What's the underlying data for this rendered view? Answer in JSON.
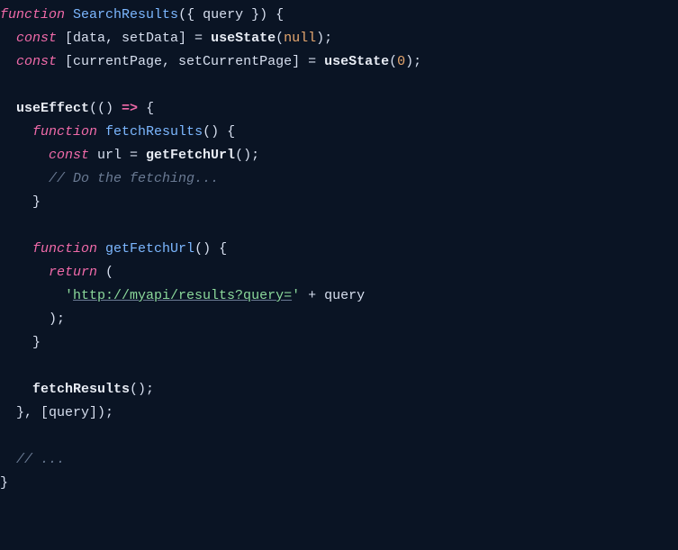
{
  "t": {
    "fn_kw": "function",
    "fn1": "SearchResults",
    "param_open": "({ ",
    "param_q": "query",
    "param_close": " }) {",
    "const_kw": "const",
    "destr1": " [data, setData] = ",
    "useState": "useState",
    "paren_o": "(",
    "null": "null",
    "paren_c": ")",
    "semi": ";",
    "destr2": " [currentPage, setCurrentPage] = ",
    "zero": "0",
    "useEffect": "useEffect",
    "arrow_args": "(() ",
    "arrow": "=>",
    "arrow_brace": " {",
    "fn2": "fetchResults",
    "empty_call": "() {",
    "url_var": " url = ",
    "getFetchUrl": "getFetchUrl",
    "call_end": "();",
    "comment1": "// Do the fetching...",
    "brace_c": "}",
    "return_kw": "return",
    "return_paren": " (",
    "str_q1": "'",
    "url_str": "http://myapi/results?query=",
    "str_q2": "'",
    "plus": " + ",
    "query_ref": "query",
    "close_paren_semi": ");",
    "fetch_call": "fetchResults",
    "dep_open": "}, [",
    "dep_q": "query",
    "dep_close": "]);",
    "comment2": "// ...",
    "sp1": "  ",
    "sp2": "    ",
    "sp3": "      ",
    "sp4": "        "
  }
}
